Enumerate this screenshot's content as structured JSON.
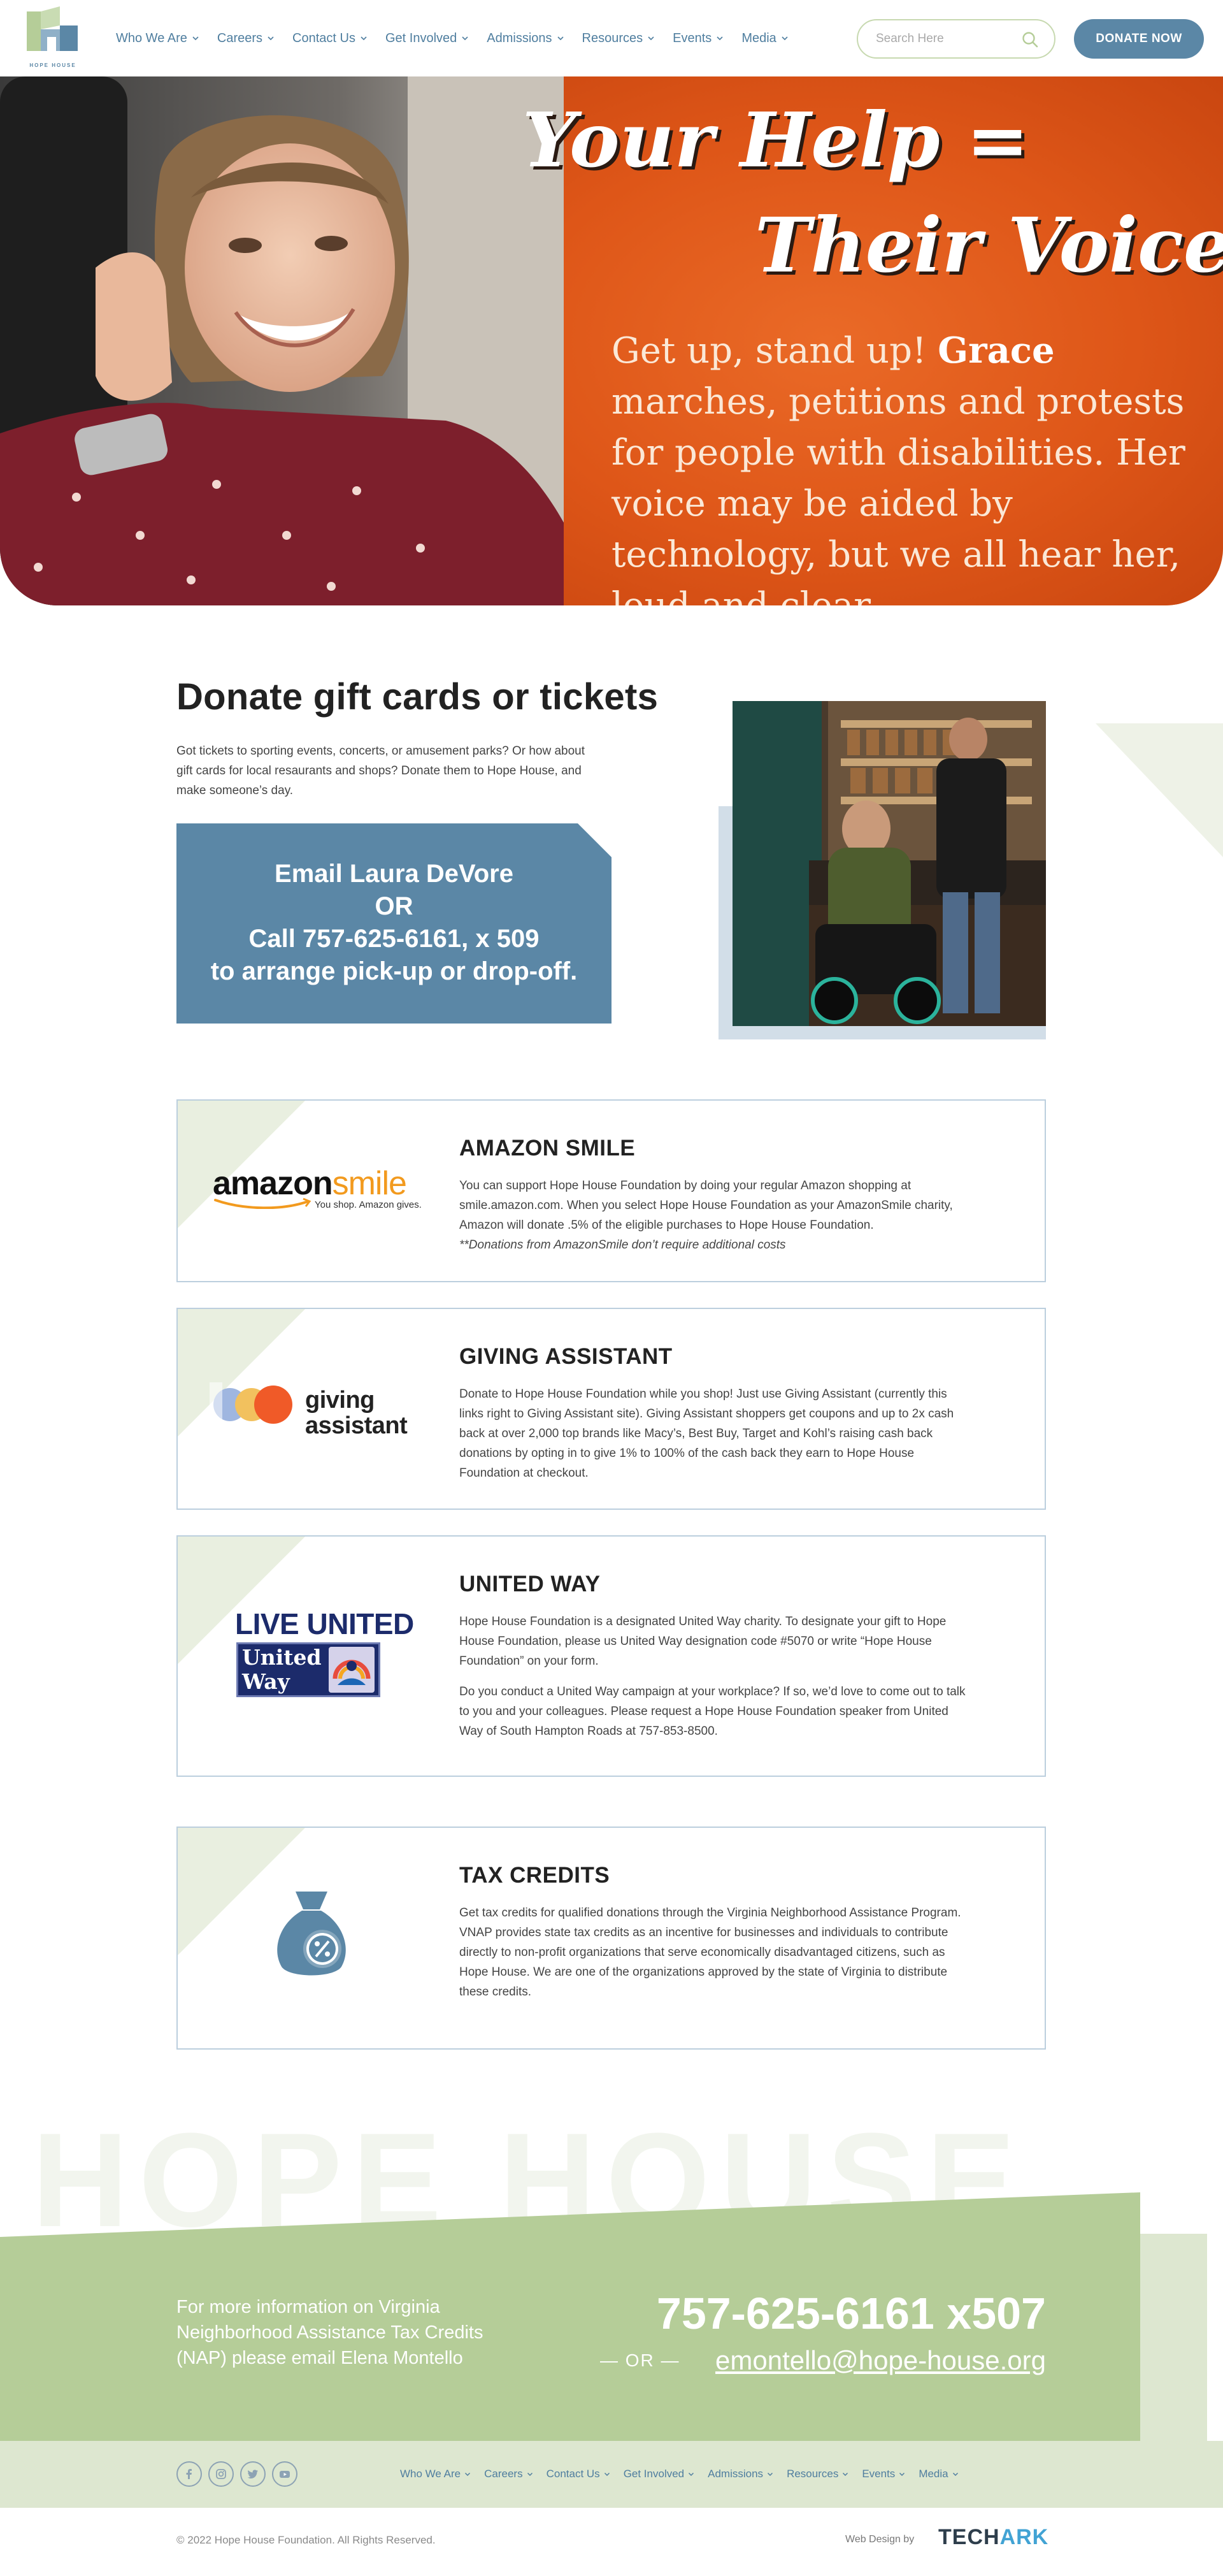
{
  "header": {
    "logo_text": "HOPE HOUSE",
    "nav": [
      {
        "label": "Who We Are"
      },
      {
        "label": "Careers"
      },
      {
        "label": "Contact Us"
      },
      {
        "label": "Get Involved"
      },
      {
        "label": "Admissions"
      },
      {
        "label": "Resources"
      },
      {
        "label": "Events"
      },
      {
        "label": "Media"
      }
    ],
    "search_placeholder": "Search Here",
    "donate_label": "DONATE NOW"
  },
  "hero": {
    "title_line1": "Your Help =",
    "title_line2": "Their Voice",
    "body_part1": "Get up, stand up! ",
    "body_bold": "Grace",
    "body_part2": " marches, petitions and protests for people with disabilities. Her voice may be aided by technology, but we all hear her, loud and clear."
  },
  "donate_section": {
    "title": "Donate gift cards or tickets",
    "text": "Got tickets to sporting events, concerts, or amusement parks?  Or how about gift cards for local resaurants and shops?  Donate them to Hope House, and make someone’s day.",
    "cta_lines": [
      "Email Laura DeVore",
      "OR",
      "Call 757-625-6161, x 509",
      "to arrange pick-up or drop-off."
    ]
  },
  "cards": [
    {
      "title": "AMAZON SMILE",
      "logo_main": "amazon",
      "logo_accent": "smile",
      "logo_tagline": "You shop. Amazon gives.",
      "paragraphs": [
        "You can support Hope House Foundation by doing your regular Amazon shopping at smile.amazon.com.  When you select Hope House Foundation as your AmazonSmile charity,  Amazon will donate .5% of the eligible purchases to Hope House Foundation."
      ],
      "note": "**Donations from AmazonSmile don’t require additional costs"
    },
    {
      "title": "GIVING ASSISTANT",
      "logo_line1": "giving",
      "logo_line2": "assistant",
      "paragraphs": [
        "Donate to Hope House Foundation while you shop!  Just use Giving Assistant (currently this links right to Giving Assistant site).  Giving Assistant shoppers get coupons and up to 2x cash back at over 2,000 top brands like Macy’s, Best Buy, Target and Kohl’s raising cash back donations by opting in to give 1% to 100% of the cash back they earn to Hope House Foundation at checkout."
      ]
    },
    {
      "title": "UNITED WAY",
      "logo_top": "LIVE UNITED",
      "logo_name_line1": "United",
      "logo_name_line2": "Way",
      "paragraphs": [
        "Hope House Foundation is a designated United Way charity.  To designate your gift to Hope House Foundation, please us United Way designation code #5070 or write “Hope House Foundation” on your form.",
        "Do you conduct a United Way campaign at your workplace?  If so, we’d love to come out to talk to you and your colleagues.  Please request a Hope House Foundation speaker from United Way of South Hampton Roads at 757-853-8500."
      ]
    },
    {
      "title": "TAX CREDITS",
      "icon": "money-bag-percent-icon",
      "paragraphs": [
        "Get tax credits for qualified donations through the Virginia Neighborhood Assistance Program.  VNAP provides state tax credits as an incentive for businesses and individuals to contribute directly to non-profit organizations that serve economically disadvantaged citizens, such as Hope House.  We are one of the organizations approved by the state of Virginia to distribute these credits."
      ]
    }
  ],
  "footer": {
    "wordmark": "HOPE HOUSE",
    "info_text": "For more information on Virginia Neighborhood Assistance Tax Credits (NAP) please email Elena Montello",
    "phone": "757-625-6161 x507",
    "or_label": "— OR —",
    "email": "emontello@hope-house.org",
    "social": [
      "facebook-icon",
      "instagram-icon",
      "twitter-icon",
      "youtube-icon"
    ],
    "nav": [
      {
        "label": "Who We Are"
      },
      {
        "label": "Careers"
      },
      {
        "label": "Contact Us"
      },
      {
        "label": "Get Involved"
      },
      {
        "label": "Admissions"
      },
      {
        "label": "Resources"
      },
      {
        "label": "Events"
      },
      {
        "label": "Media"
      }
    ],
    "copyright": "© 2022 Hope House Foundation. All Rights Reserved.",
    "webdesign_label": "Web Design by",
    "webdesign_brand_a": "TECH",
    "webdesign_brand_b": "ARK"
  },
  "colors": {
    "brand_blue": "#5b87a6",
    "hero_orange": "#e05a1e",
    "footer_green": "#b5cd98",
    "card_border": "#bccfde"
  }
}
